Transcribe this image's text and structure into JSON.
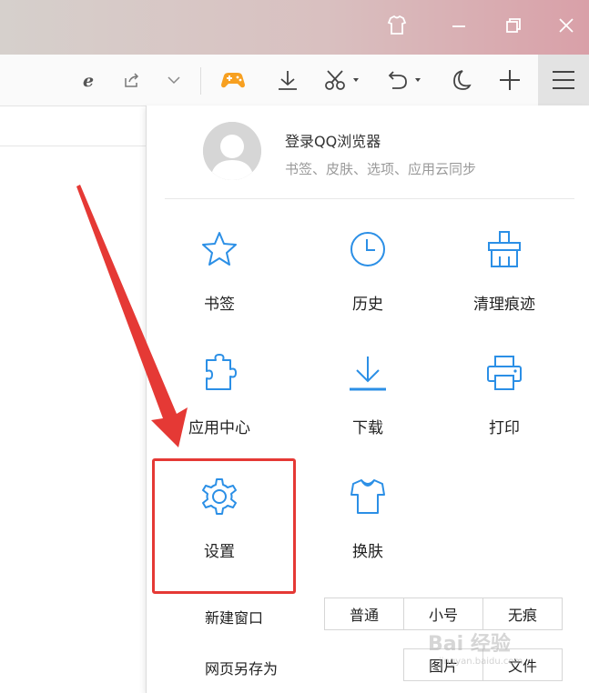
{
  "window": {
    "skin_icon": "shirt-icon",
    "minimize_icon": "minimize-icon",
    "restore_icon": "restore-icon",
    "close_icon": "close-icon"
  },
  "toolbar": {
    "icons": [
      "ie-icon",
      "share-icon",
      "chevron-down-icon",
      "game-icon",
      "download-icon",
      "scissors-icon",
      "undo-icon",
      "moon-icon",
      "plus-icon",
      "hamburger-menu-icon"
    ]
  },
  "menu": {
    "login_title": "登录QQ浏览器",
    "login_subtitle": "书签、皮肤、选项、应用云同步",
    "items": [
      {
        "label": "书签",
        "icon": "star-icon"
      },
      {
        "label": "历史",
        "icon": "clock-icon"
      },
      {
        "label": "清理痕迹",
        "icon": "broom-icon"
      },
      {
        "label": "应用中心",
        "icon": "puzzle-icon"
      },
      {
        "label": "下载",
        "icon": "download-icon"
      },
      {
        "label": "打印",
        "icon": "printer-icon"
      },
      {
        "label": "设置",
        "icon": "gear-icon"
      },
      {
        "label": "换肤",
        "icon": "shirt-icon"
      }
    ],
    "new_window": {
      "label": "新建窗口",
      "options": [
        "普通",
        "小号",
        "无痕"
      ]
    },
    "save_as": {
      "label": "网页另存为",
      "options": [
        "图片",
        "文件"
      ]
    }
  },
  "watermark": {
    "text": "Bai 经验",
    "url": "jingyan.baidu.com"
  },
  "colors": {
    "accent_blue": "#2b8fe6",
    "highlight_red": "#e53935",
    "game_orange": "#f7a021"
  }
}
